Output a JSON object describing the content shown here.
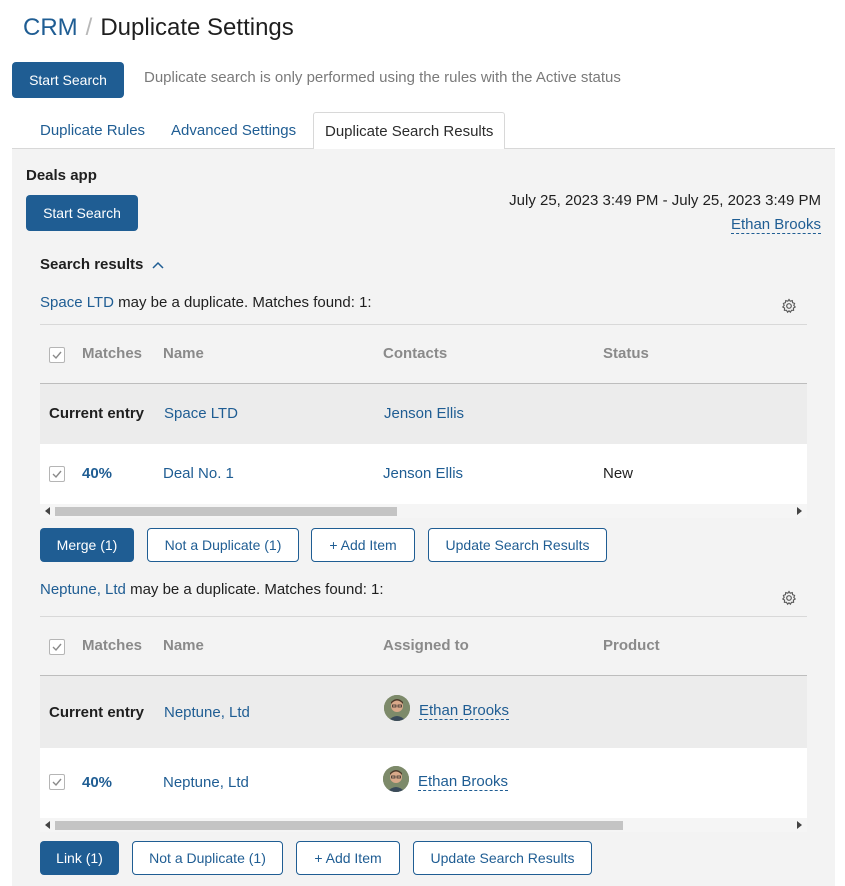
{
  "breadcrumb": {
    "root": "CRM",
    "separator": "/",
    "page_title": "Duplicate Settings"
  },
  "toolbar": {
    "start_search_label": "Start Search",
    "hint": "Duplicate search is only performed using the rules with the Active status"
  },
  "tabs": [
    {
      "label": "Duplicate Rules",
      "active": false
    },
    {
      "label": "Advanced Settings",
      "active": false
    },
    {
      "label": "Duplicate Search Results",
      "active": true
    }
  ],
  "app_section": {
    "title": "Deals app",
    "start_search_label": "Start Search",
    "date_range": "July 25, 2023 3:49 PM - July 25, 2023 3:49 PM",
    "user": "Ethan Brooks",
    "results_title": "Search results"
  },
  "groups": [
    {
      "entry_link": "Space LTD",
      "entry_suffix": " may be a duplicate. Matches found: 1:",
      "columns": [
        "Matches",
        "Name",
        "Contacts",
        "Status"
      ],
      "current": {
        "label": "Current entry",
        "name": "Space LTD",
        "col3": "Jenson Ellis",
        "col4": ""
      },
      "match": {
        "pct": "40%",
        "name": "Deal No. 1",
        "col3": "Jenson Ellis",
        "col4": "New"
      },
      "actions": {
        "primary": "Merge (1)",
        "not_dup": "Not a Duplicate (1)",
        "add": "+ Add Item",
        "update": "Update Search Results"
      }
    },
    {
      "entry_link": "Neptune, Ltd",
      "entry_suffix": " may be a duplicate. Matches found: 1:",
      "columns": [
        "Matches",
        "Name",
        "Assigned to",
        "Product"
      ],
      "current": {
        "label": "Current entry",
        "name": "Neptune, Ltd",
        "col3": "Ethan Brooks",
        "col4": ""
      },
      "match": {
        "pct": "40%",
        "name": "Neptune, Ltd",
        "col3": "Ethan Brooks",
        "col4": ""
      },
      "actions": {
        "primary": "Link (1)",
        "not_dup": "Not a Duplicate (1)",
        "add": "+ Add Item",
        "update": "Update Search Results"
      }
    }
  ],
  "colors": {
    "accent": "#1f5d93",
    "panel_bg": "#f3f3f3"
  }
}
